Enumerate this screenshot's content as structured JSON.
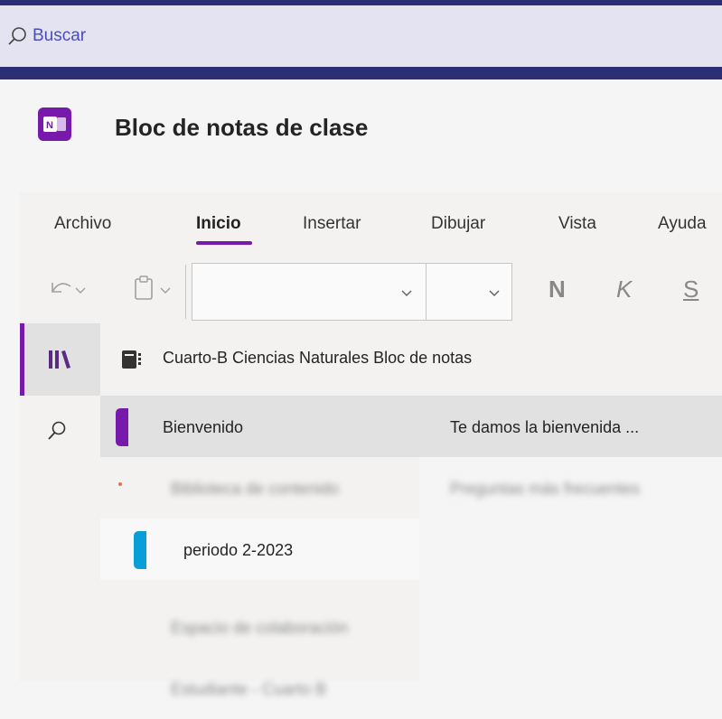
{
  "search": {
    "label": "Buscar",
    "icon": "search-icon"
  },
  "app": {
    "title": "Bloc de notas de clase",
    "logo_text": "N",
    "accent": "#7719aa"
  },
  "ribbon": {
    "tabs": [
      {
        "label": "Archivo",
        "active": false
      },
      {
        "label": "Inicio",
        "active": true
      },
      {
        "label": "Insertar",
        "active": false
      },
      {
        "label": "Dibujar",
        "active": false
      },
      {
        "label": "Vista",
        "active": false
      },
      {
        "label": "Ayuda",
        "active": false
      }
    ],
    "format_buttons": {
      "bold": "N",
      "italic": "K",
      "underline": "S"
    },
    "font_value": "",
    "size_value": ""
  },
  "nav": {
    "items": [
      "notebooks-icon",
      "search-icon"
    ]
  },
  "notebook": {
    "title": "Cuarto-B Ciencias Naturales Bloc de notas"
  },
  "sections": [
    {
      "label": "Bienvenido",
      "color": "#7719aa",
      "selected": true
    },
    {
      "label": "Biblioteca de contenido",
      "color": "#e2725b",
      "blurred": true
    },
    {
      "label": "periodo 2-2023",
      "color": "#0a9ed9",
      "indent": true
    },
    {
      "label": "Espacio de colaboración",
      "color": "#9b9b9b",
      "blurred": true
    },
    {
      "label": "Estudiante - Cuarto B",
      "color": "#9b9b9b",
      "blurred": true
    }
  ],
  "pages": [
    {
      "label": "Te damos la bienvenida ...",
      "selected": true
    },
    {
      "label": "Preguntas más frecuentes",
      "blurred": true
    }
  ]
}
